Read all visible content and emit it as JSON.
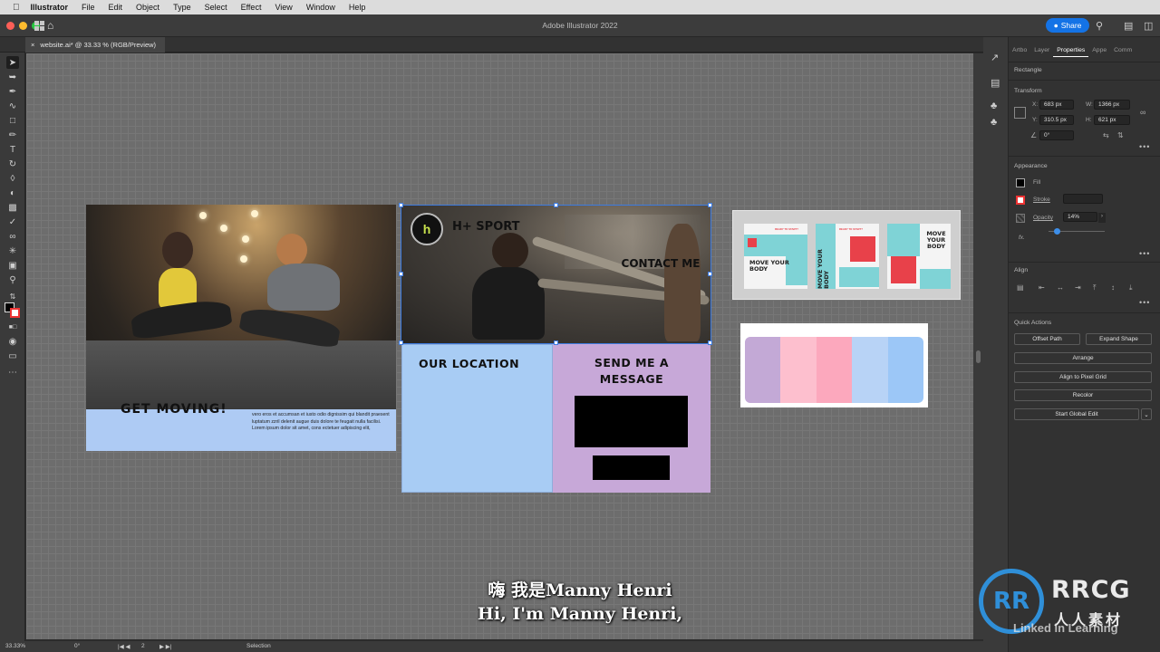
{
  "menubar": {
    "app": "Illustrator",
    "items": [
      "File",
      "Edit",
      "Object",
      "Type",
      "Select",
      "Effect",
      "View",
      "Window",
      "Help"
    ]
  },
  "titlebar": {
    "title": "Adobe Illustrator 2022",
    "share": "Share"
  },
  "document_tab": {
    "label": "website.ai* @ 33.33 % (RGB/Preview)"
  },
  "artboard1": {
    "heading": "GET MOVING!",
    "body": "vero eros et accumsan et iusto odio dignissim qui blandit praesent luptatum zzril delenit augue duis dolore te feugait nulla facilisi.",
    "body2": "Lorem ipsum dolor sit amet, cons ectetuer adipiscing elit,"
  },
  "artboard2": {
    "logo_letter": "h",
    "brand": "H+ SPORT",
    "contact": "CONTACT ME",
    "location": "OUR LOCATION",
    "message": "SEND ME A MESSAGE"
  },
  "artboard3": {
    "post1": "MOVE YOUR BODY",
    "post2": "MOVE YOUR BODY",
    "post3": "MOVE YOUR BODY",
    "tagline": "READY TO START?"
  },
  "palette": {
    "colors": [
      "#c3a9d6",
      "#fdbfce",
      "#fca8bd",
      "#b8d3f6",
      "#9cc7f7"
    ]
  },
  "properties_panel": {
    "tabs": [
      "Artbo",
      "Layer",
      "Properties",
      "Appe",
      "Comm"
    ],
    "active_tab": "Properties",
    "object_type": "Rectangle",
    "transform": {
      "title": "Transform",
      "x_label": "X:",
      "x": "683 px",
      "y_label": "Y:",
      "y": "310.5 px",
      "w_label": "W:",
      "w": "1366 px",
      "h_label": "H:",
      "h": "621 px",
      "angle": "0°"
    },
    "appearance": {
      "title": "Appearance",
      "fill": "Fill",
      "stroke": "Stroke",
      "opacity_label": "Opacity",
      "opacity": "14%",
      "opacity_fraction": 0.14,
      "fx": "fx."
    },
    "align": {
      "title": "Align"
    },
    "quick_actions": {
      "title": "Quick Actions",
      "offset_path": "Offset Path",
      "expand_shape": "Expand Shape",
      "arrange": "Arrange",
      "align_pixel": "Align to Pixel Grid",
      "recolor": "Recolor",
      "global_edit": "Start Global Edit"
    }
  },
  "statusbar": {
    "zoom": "33.33%",
    "rotation": "0°",
    "artboard": "2",
    "tool": "Selection"
  },
  "subtitles": {
    "cn": "嗨 我是Manny Henri",
    "en": "Hi, I'm Manny Henri,"
  },
  "watermark": {
    "brand": "RRCG",
    "cn": "人人素材",
    "linkedin": "Linked in Learning"
  },
  "accent": "#1473e6"
}
